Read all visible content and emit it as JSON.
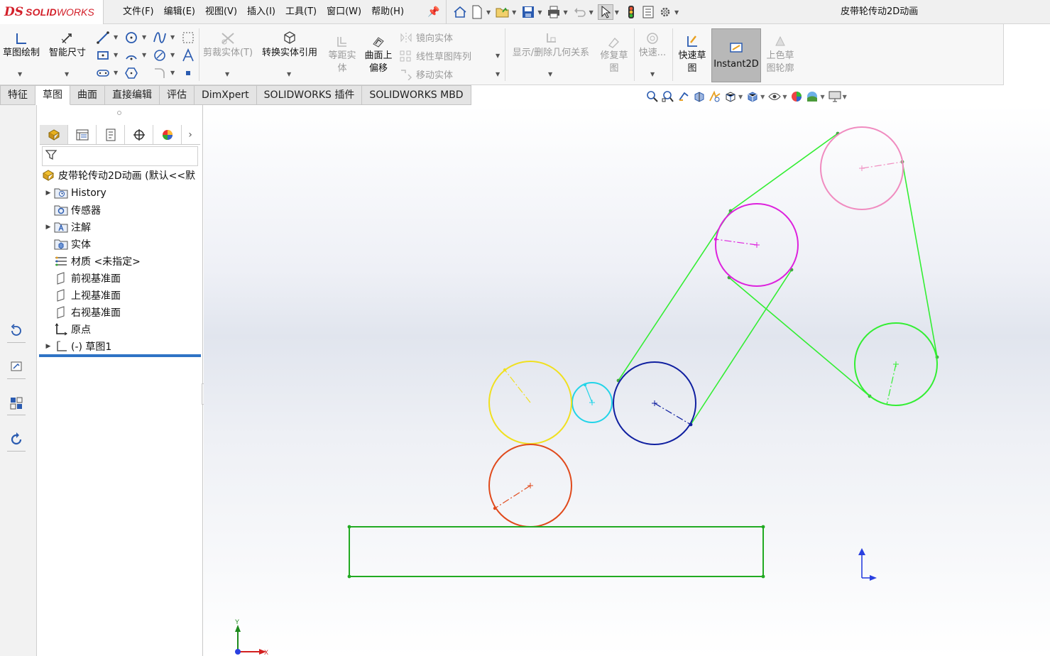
{
  "app": {
    "logo_text_ds": "DS",
    "logo_text_solid": "SOLID",
    "logo_text_works": "WORKS",
    "document_title": "皮带轮传动2D动画"
  },
  "menus": [
    "文件(F)",
    "编辑(E)",
    "视图(V)",
    "插入(I)",
    "工具(T)",
    "窗口(W)",
    "帮助(H)"
  ],
  "command_manager": {
    "sketch": "草图绘制",
    "smart_dimension": "智能尺寸",
    "trim": "剪裁实体(T)",
    "convert": "转换实体引用",
    "offset_line1": "等距实",
    "offset_line2": "体",
    "surface_offset_line1": "曲面上",
    "surface_offset_line2": "偏移",
    "mirror": "镜向实体",
    "linear_pattern": "线性草图阵列",
    "move": "移动实体",
    "display_relations": "显示/删除几何关系",
    "repair_line1": "修复草",
    "repair_line2": "图",
    "quick_snap": "快速...",
    "rapid_sketch_line1": "快速草",
    "rapid_sketch_line2": "图",
    "instant2d": "Instant2D",
    "shaded_line1": "上色草",
    "shaded_line2": "图轮廓"
  },
  "tabs": [
    "特征",
    "草图",
    "曲面",
    "直接编辑",
    "评估",
    "DimXpert",
    "SOLIDWORKS 插件",
    "SOLIDWORKS MBD"
  ],
  "active_tab": "草图",
  "feature_tree": {
    "root": "皮带轮传动2D动画 (默认<<默",
    "items": [
      {
        "label": "History",
        "expandable": true
      },
      {
        "label": "传感器",
        "expandable": false
      },
      {
        "label": "注解",
        "expandable": true
      },
      {
        "label": "实体",
        "expandable": false
      },
      {
        "label": "材质 <未指定>",
        "expandable": false
      },
      {
        "label": "前视基准面",
        "expandable": false
      },
      {
        "label": "上视基准面",
        "expandable": false
      },
      {
        "label": "右视基准面",
        "expandable": false
      },
      {
        "label": "原点",
        "expandable": false
      },
      {
        "label": "(-) 草图1",
        "expandable": true
      }
    ]
  },
  "triad": {
    "x_label": "X",
    "y_label": "Y"
  },
  "colors": {
    "accent_blue": "#2f73c5",
    "brand_red": "#d3202a",
    "belt_green": "#33ee33",
    "pulley_pink": "#f08cc0",
    "pulley_magenta": "#dd22dd",
    "pulley_green": "#33ee33",
    "pulley_blue": "#1020a0",
    "pulley_cyan": "#22d4e8",
    "pulley_yellow": "#f0e020",
    "pulley_orange": "#e04a1c",
    "base_rect": "#22aa22"
  }
}
